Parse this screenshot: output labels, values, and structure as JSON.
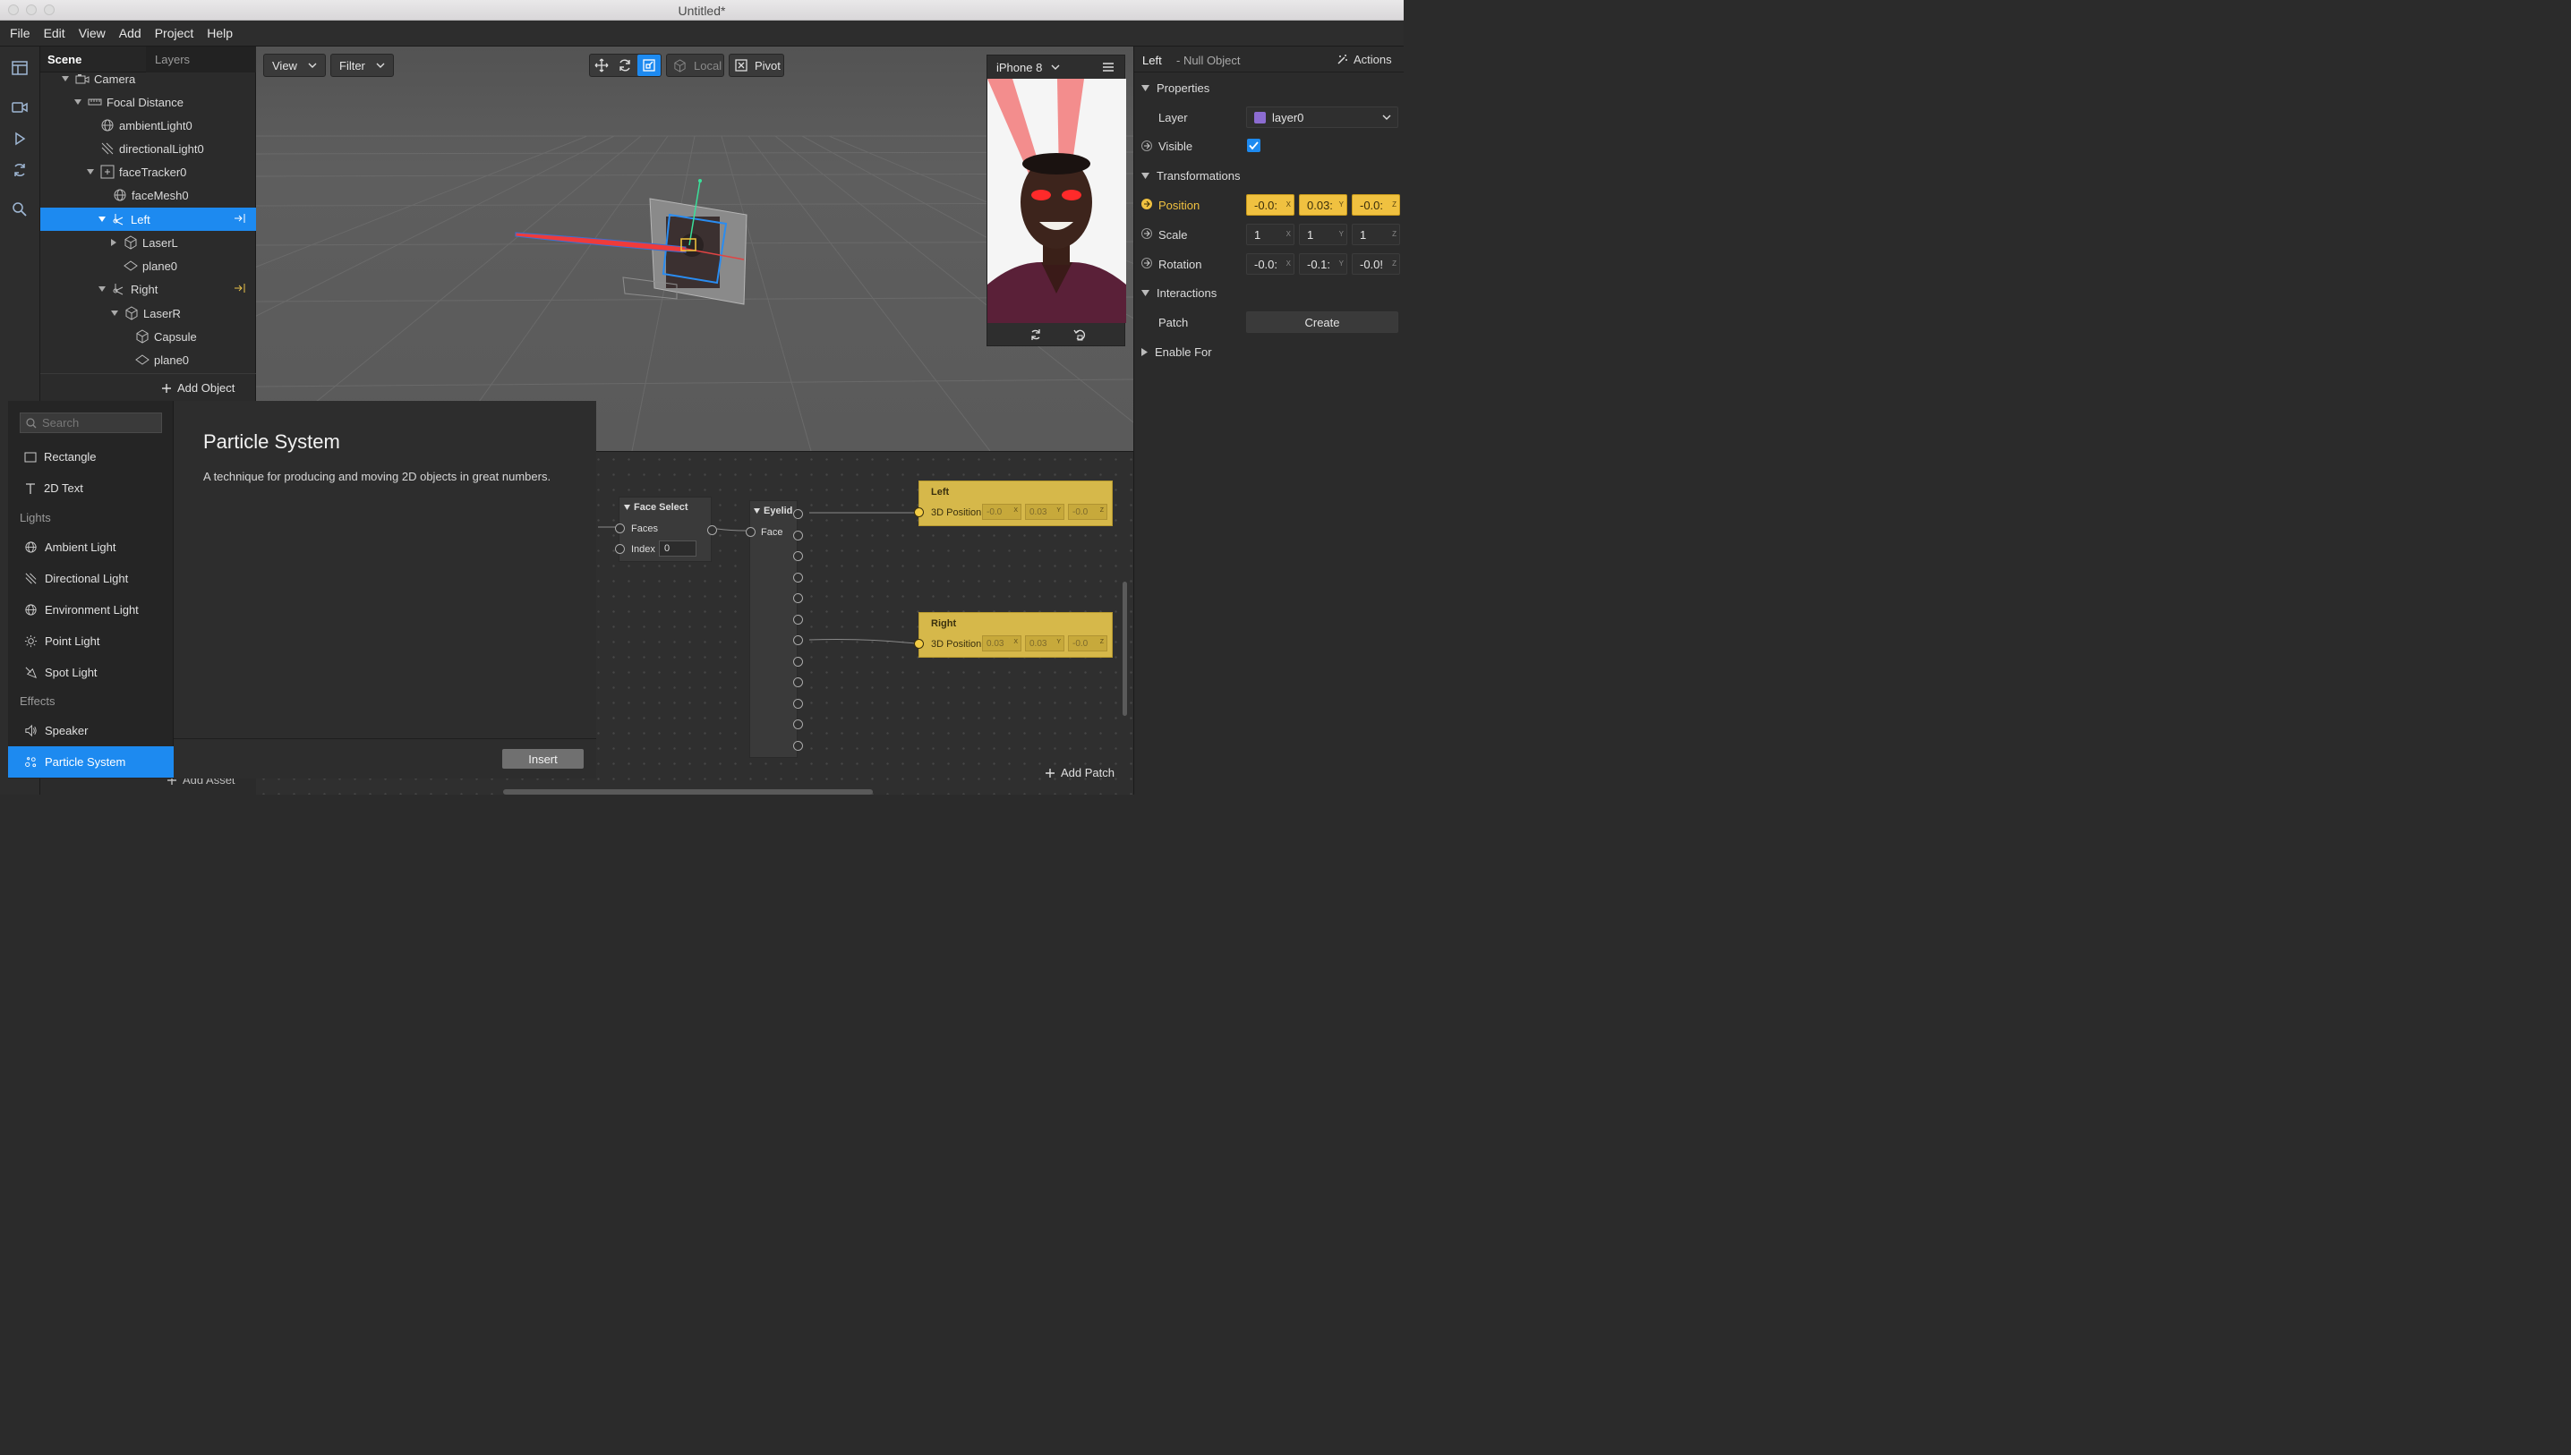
{
  "window": {
    "title": "Untitled*"
  },
  "menu": [
    "File",
    "Edit",
    "View",
    "Add",
    "Project",
    "Help"
  ],
  "scene_panel": {
    "tabs": [
      "Scene",
      "Layers"
    ],
    "tree": [
      {
        "label": "Camera",
        "icon": "camera-icon",
        "depth": 1,
        "expanded": true
      },
      {
        "label": "Focal Distance",
        "icon": "ruler-icon",
        "depth": 2,
        "expanded": true
      },
      {
        "label": "ambientLight0",
        "icon": "globe-icon",
        "depth": 3
      },
      {
        "label": "directionalLight0",
        "icon": "directional-light-icon",
        "depth": 3
      },
      {
        "label": "faceTracker0",
        "icon": "face-tracker-icon",
        "depth": 3,
        "expanded": true
      },
      {
        "label": "faceMesh0",
        "icon": "globe-icon",
        "depth": 4
      },
      {
        "label": "Left",
        "icon": "null-object-icon",
        "depth": 4,
        "expanded": true,
        "selected": true
      },
      {
        "label": "LaserL",
        "icon": "cube-icon",
        "depth": 5,
        "collapsed": true
      },
      {
        "label": "plane0",
        "icon": "plane-icon",
        "depth": 5
      },
      {
        "label": "Right",
        "icon": "null-object-icon",
        "depth": 4,
        "expanded": true
      },
      {
        "label": "LaserR",
        "icon": "cube-icon",
        "depth": 5,
        "expanded": true
      },
      {
        "label": "Capsule",
        "icon": "cube-icon",
        "depth": 6
      },
      {
        "label": "plane0",
        "icon": "plane-icon",
        "depth": 6
      }
    ],
    "add_object": "Add Object",
    "add_asset": "Add Asset"
  },
  "viewport": {
    "view_label": "View",
    "filter_label": "Filter",
    "local_label": "Local",
    "pivot_label": "Pivot",
    "device": "iPhone 8"
  },
  "inspector": {
    "object_name": "Left",
    "object_type": "- Null Object",
    "actions_label": "Actions",
    "properties_label": "Properties",
    "layer_label": "Layer",
    "layer_value": "layer0",
    "layer_color": "#8c6cd1",
    "visible_label": "Visible",
    "transformations_label": "Transformations",
    "position_label": "Position",
    "position": [
      "-0.0:",
      "0.03:",
      "-0.0:"
    ],
    "scale_label": "Scale",
    "scale": [
      "1",
      "1",
      "1"
    ],
    "rotation_label": "Rotation",
    "rotation": [
      "-0.0:",
      "-0.1:",
      "-0.0!"
    ],
    "interactions_label": "Interactions",
    "patch_label": "Patch",
    "create_label": "Create",
    "enable_for_label": "Enable For",
    "axes": [
      "X",
      "Y",
      "Z"
    ]
  },
  "patch_editor": {
    "face_select": {
      "title": "Face Select",
      "faces": "Faces",
      "index": "Index",
      "index_value": "0"
    },
    "eyelid": {
      "title": "Eyelid",
      "face": "Face"
    },
    "left": {
      "title": "Left",
      "port": "3D Position",
      "values": [
        "-0.0",
        "0.03",
        "-0.0"
      ]
    },
    "right": {
      "title": "Right",
      "port": "3D Position",
      "values": [
        "0.03",
        "0.03",
        "-0.0"
      ]
    },
    "add_patch": "Add Patch"
  },
  "asset_popup": {
    "search_placeholder": "Search",
    "items_top": [
      "Rectangle",
      "2D Text"
    ],
    "category_lights": "Lights",
    "lights": [
      "Ambient Light",
      "Directional Light",
      "Environment Light",
      "Point Light",
      "Spot Light"
    ],
    "category_effects": "Effects",
    "effects": [
      "Speaker",
      "Particle System"
    ],
    "detail_title": "Particle System",
    "detail_description": "A technique for producing and moving 2D objects in great numbers.",
    "insert_label": "Insert"
  },
  "colors": {
    "accent": "#1d8af0",
    "patch_yellow": "#d6b84a",
    "highlight": "#f0c140"
  }
}
